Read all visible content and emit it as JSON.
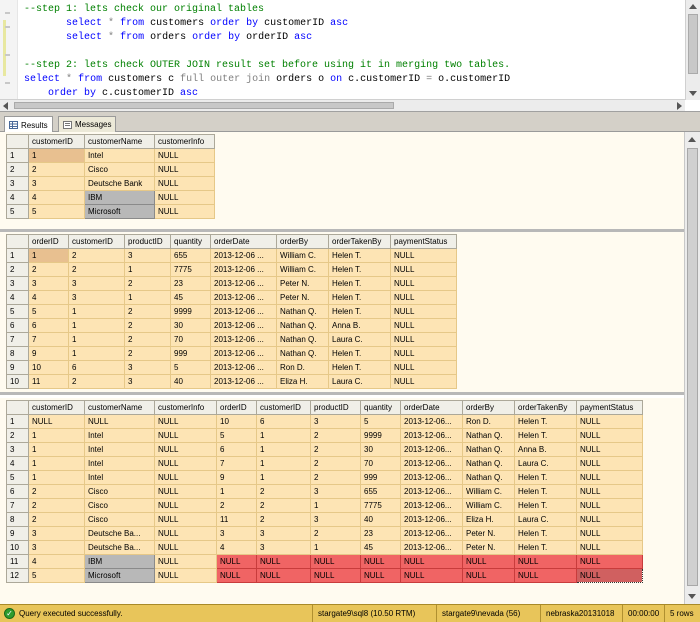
{
  "editor": {
    "lines": [
      {
        "parts": [
          {
            "c": "cm",
            "t": "--step 1: lets check our original tables"
          }
        ]
      },
      {
        "parts": [
          {
            "c": "",
            "t": "       "
          },
          {
            "c": "kw",
            "t": "select"
          },
          {
            "c": "",
            "t": " "
          },
          {
            "c": "gy",
            "t": "*"
          },
          {
            "c": "",
            "t": " "
          },
          {
            "c": "kw",
            "t": "from"
          },
          {
            "c": "",
            "t": " customers "
          },
          {
            "c": "kw",
            "t": "order by"
          },
          {
            "c": "",
            "t": " customerID "
          },
          {
            "c": "kw",
            "t": "asc"
          }
        ]
      },
      {
        "parts": [
          {
            "c": "",
            "t": "       "
          },
          {
            "c": "kw",
            "t": "select"
          },
          {
            "c": "",
            "t": " "
          },
          {
            "c": "gy",
            "t": "*"
          },
          {
            "c": "",
            "t": " "
          },
          {
            "c": "kw",
            "t": "from"
          },
          {
            "c": "",
            "t": " orders "
          },
          {
            "c": "kw",
            "t": "order by"
          },
          {
            "c": "",
            "t": " orderID "
          },
          {
            "c": "kw",
            "t": "asc"
          }
        ]
      },
      {
        "parts": [
          {
            "c": "",
            "t": " "
          }
        ]
      },
      {
        "parts": [
          {
            "c": "cm",
            "t": "--step 2: lets check OUTER JOIN result set before using it in merging two tables."
          }
        ]
      },
      {
        "parts": [
          {
            "c": "kw",
            "t": "select"
          },
          {
            "c": "",
            "t": " "
          },
          {
            "c": "gy",
            "t": "*"
          },
          {
            "c": "",
            "t": " "
          },
          {
            "c": "kw",
            "t": "from"
          },
          {
            "c": "",
            "t": " customers c "
          },
          {
            "c": "gy",
            "t": "full outer join"
          },
          {
            "c": "",
            "t": " orders o "
          },
          {
            "c": "kw",
            "t": "on"
          },
          {
            "c": "",
            "t": " c.customerID "
          },
          {
            "c": "gy",
            "t": "="
          },
          {
            "c": "",
            "t": " o.customerID"
          }
        ]
      },
      {
        "parts": [
          {
            "c": "",
            "t": "    "
          },
          {
            "c": "kw",
            "t": "order by"
          },
          {
            "c": "",
            "t": " c.customerID "
          },
          {
            "c": "kw",
            "t": "asc"
          }
        ]
      }
    ]
  },
  "tabs": [
    {
      "label": "Results",
      "icon": "grid-icon"
    },
    {
      "label": "Messages",
      "icon": "messages-icon"
    }
  ],
  "grid1": {
    "columns": [
      "customerID",
      "customerName",
      "customerInfo"
    ],
    "rows": [
      [
        "1",
        "1",
        "Intel",
        "NULL"
      ],
      [
        "2",
        "2",
        "Cisco",
        "NULL"
      ],
      [
        "3",
        "3",
        "Deutsche Bank",
        "NULL"
      ],
      [
        "4",
        "4",
        "IBM",
        "NULL"
      ],
      [
        "5",
        "5",
        "Microsoft",
        "NULL"
      ]
    ]
  },
  "grid2": {
    "columns": [
      "orderID",
      "customerID",
      "productID",
      "quantity",
      "orderDate",
      "orderBy",
      "orderTakenBy",
      "paymentStatus"
    ],
    "rows": [
      [
        "1",
        "1",
        "2",
        "3",
        "655",
        "2013-12-06 ...",
        "William C.",
        "Helen T.",
        "NULL"
      ],
      [
        "2",
        "2",
        "2",
        "1",
        "7775",
        "2013-12-06 ...",
        "William C.",
        "Helen T.",
        "NULL"
      ],
      [
        "3",
        "3",
        "3",
        "2",
        "23",
        "2013-12-06 ...",
        "Peter N.",
        "Helen T.",
        "NULL"
      ],
      [
        "4",
        "4",
        "3",
        "1",
        "45",
        "2013-12-06 ...",
        "Peter N.",
        "Helen T.",
        "NULL"
      ],
      [
        "5",
        "5",
        "1",
        "2",
        "9999",
        "2013-12-06 ...",
        "Nathan Q.",
        "Helen T.",
        "NULL"
      ],
      [
        "6",
        "6",
        "1",
        "2",
        "30",
        "2013-12-06 ...",
        "Nathan Q.",
        "Anna B.",
        "NULL"
      ],
      [
        "7",
        "7",
        "1",
        "2",
        "70",
        "2013-12-06 ...",
        "Nathan Q.",
        "Laura C.",
        "NULL"
      ],
      [
        "8",
        "9",
        "1",
        "2",
        "999",
        "2013-12-06 ...",
        "Nathan Q.",
        "Helen T.",
        "NULL"
      ],
      [
        "9",
        "10",
        "6",
        "3",
        "5",
        "2013-12-06 ...",
        "Ron D.",
        "Helen T.",
        "NULL"
      ],
      [
        "10",
        "11",
        "2",
        "3",
        "40",
        "2013-12-06 ...",
        "Eliza H.",
        "Laura C.",
        "NULL"
      ]
    ]
  },
  "grid3": {
    "columns": [
      "customerID",
      "customerName",
      "customerInfo",
      "orderID",
      "customerID",
      "productID",
      "quantity",
      "orderDate",
      "orderBy",
      "orderTakenBy",
      "paymentStatus"
    ],
    "rows": [
      [
        "1",
        "NULL",
        "NULL",
        "NULL",
        "10",
        "6",
        "3",
        "5",
        "2013-12-06...",
        "Ron D.",
        "Helen T.",
        "NULL"
      ],
      [
        "2",
        "1",
        "Intel",
        "NULL",
        "5",
        "1",
        "2",
        "9999",
        "2013-12-06...",
        "Nathan Q.",
        "Helen T.",
        "NULL"
      ],
      [
        "3",
        "1",
        "Intel",
        "NULL",
        "6",
        "1",
        "2",
        "30",
        "2013-12-06...",
        "Nathan Q.",
        "Anna B.",
        "NULL"
      ],
      [
        "4",
        "1",
        "Intel",
        "NULL",
        "7",
        "1",
        "2",
        "70",
        "2013-12-06...",
        "Nathan Q.",
        "Laura C.",
        "NULL"
      ],
      [
        "5",
        "1",
        "Intel",
        "NULL",
        "9",
        "1",
        "2",
        "999",
        "2013-12-06...",
        "Nathan Q.",
        "Helen T.",
        "NULL"
      ],
      [
        "6",
        "2",
        "Cisco",
        "NULL",
        "1",
        "2",
        "3",
        "655",
        "2013-12-06...",
        "William C.",
        "Helen T.",
        "NULL"
      ],
      [
        "7",
        "2",
        "Cisco",
        "NULL",
        "2",
        "2",
        "1",
        "7775",
        "2013-12-06...",
        "William C.",
        "Helen T.",
        "NULL"
      ],
      [
        "8",
        "2",
        "Cisco",
        "NULL",
        "11",
        "2",
        "3",
        "40",
        "2013-12-06...",
        "Eliza H.",
        "Laura C.",
        "NULL"
      ],
      [
        "9",
        "3",
        "Deutsche Ba...",
        "NULL",
        "3",
        "3",
        "2",
        "23",
        "2013-12-06...",
        "Peter N.",
        "Helen T.",
        "NULL"
      ],
      [
        "10",
        "3",
        "Deutsche Ba...",
        "NULL",
        "4",
        "3",
        "1",
        "45",
        "2013-12-06...",
        "Peter N.",
        "Helen T.",
        "NULL"
      ],
      [
        "11",
        "4",
        "IBM",
        "NULL",
        "NULL",
        "NULL",
        "NULL",
        "NULL",
        "NULL",
        "NULL",
        "NULL",
        "NULL"
      ],
      [
        "12",
        "5",
        "Microsoft",
        "NULL",
        "NULL",
        "NULL",
        "NULL",
        "NULL",
        "NULL",
        "NULL",
        "NULL",
        "NULL"
      ]
    ]
  },
  "status": {
    "message": "Query executed successfully.",
    "server": "stargate9\\sql8 (10.50 RTM)",
    "login": "stargate9\\nevada (56)",
    "database": "nebraska20131018",
    "elapsed": "00:00:00",
    "rows": "5 rows"
  },
  "colors": {
    "cell": "#fde4b4",
    "selected": "#b8b8b8",
    "unmatched": "#f06464",
    "status_bar": "#e8c55a"
  }
}
